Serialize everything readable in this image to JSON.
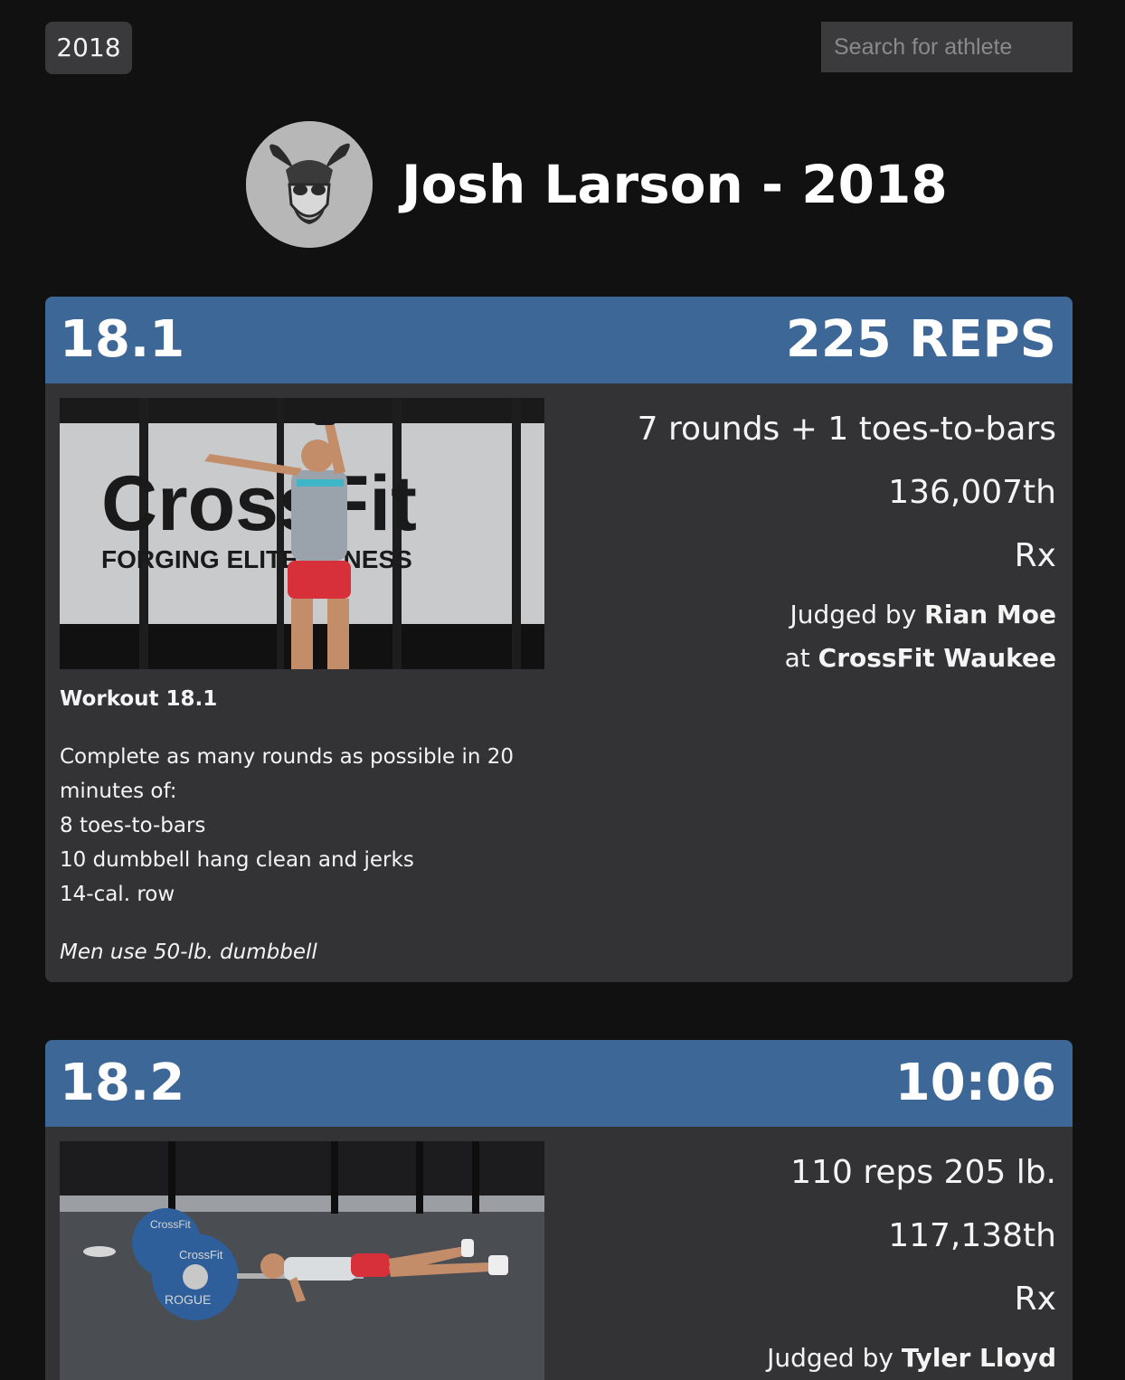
{
  "year_selector": {
    "label": "2018"
  },
  "search": {
    "placeholder": "Search for athlete"
  },
  "athlete": {
    "title": "Josh Larson - 2018"
  },
  "workouts": [
    {
      "number": "18.1",
      "score": "225 REPS",
      "result": "7 rounds + 1 toes-to-bars",
      "rank": "136,007th",
      "division": "Rx",
      "judged_prefix": "Judged by",
      "judge": "Rian Moe",
      "at_prefix": "at",
      "gym": "CrossFit Waukee",
      "image_text": {
        "top": "CrossFit",
        "bottom": "FORGING ELITE FITNESS"
      },
      "description_title": "Workout 18.1",
      "description_lines": [
        "Complete as many rounds as possible in 20",
        "minutes of:",
        "8 toes-to-bars",
        "10 dumbbell hang clean and jerks",
        "14-cal. row"
      ],
      "description_note": "Men use 50-lb. dumbbell"
    },
    {
      "number": "18.2",
      "score": "10:06",
      "result": "110 reps 205 lb.",
      "rank": "117,138th",
      "division": "Rx",
      "judged_prefix": "Judged by",
      "judge": "Tyler Lloyd",
      "image_text": {
        "plate1": "CrossFit",
        "plate2": "CrossFit",
        "brand": "ROGUE"
      }
    }
  ]
}
